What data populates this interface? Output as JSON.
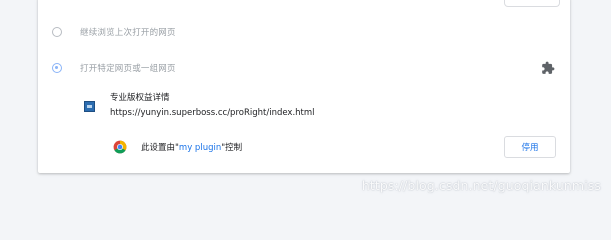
{
  "startup_options": {
    "continue_label": "继续浏览上次打开的网页",
    "specific_pages_label": "打开特定网页或一组网页",
    "selected": "specific_pages"
  },
  "page_entry": {
    "title": "专业版权益详情",
    "url": "https://yunyin.superboss.cc/proRight/index.html"
  },
  "policy": {
    "prefix": "此设置由\"",
    "extension_name": "my plugin",
    "suffix": "\"控制",
    "disable_label": "停用"
  },
  "icons": {
    "extension": "puzzle-piece-icon",
    "browser": "chrome-icon",
    "favicon": "page-favicon-icon"
  },
  "colors": {
    "accent": "#1a73e8",
    "radio_checked": "#8ab4f8"
  },
  "watermark": "https://blog.csdn.net/guoqiankunmiss"
}
